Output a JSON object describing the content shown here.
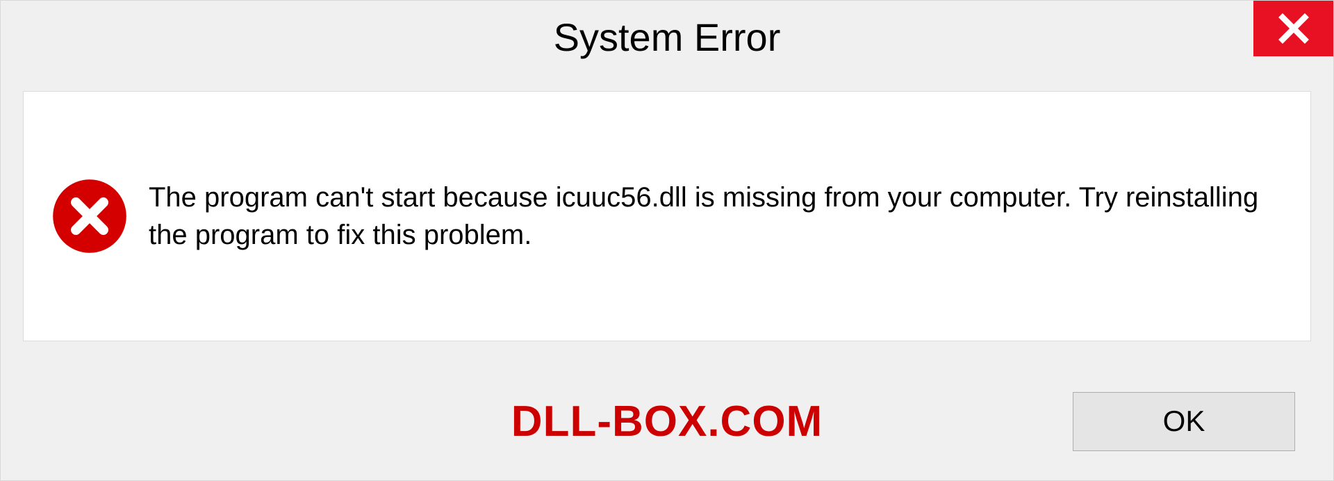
{
  "dialog": {
    "title": "System Error",
    "message": "The program can't start because icuuc56.dll is missing from your computer. Try reinstalling the program to fix this problem.",
    "ok_label": "OK"
  },
  "watermark": "DLL-BOX.COM"
}
